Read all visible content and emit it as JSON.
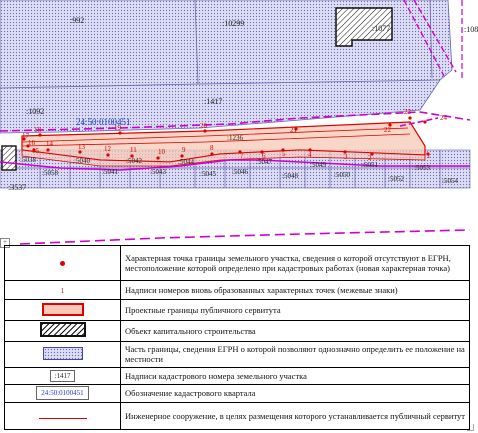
{
  "map": {
    "parcel_labels": [
      ":992",
      ":10299",
      ":1077",
      ":1086",
      ":1092",
      ":1417",
      ":3537",
      ":1236"
    ],
    "quarter_label": "24:50:0100451",
    "lower_labels": [
      ":5038",
      ":5040",
      ":5042",
      ":5044",
      ":5047",
      ":5049",
      ":5051",
      ":5053",
      ":5058",
      ":5041",
      ":5043",
      ":5045",
      ":5046",
      ":5048",
      ":5050",
      ":5052",
      ":5054"
    ],
    "points": [
      "1",
      "2",
      "3",
      "4",
      "5",
      "6",
      "7",
      "8",
      "9",
      "10",
      "11",
      "12",
      "13",
      "14",
      "15",
      "16",
      "17",
      "18",
      "19",
      "20",
      "21",
      "22",
      "23",
      "24"
    ],
    "colors": {
      "servitude": "#e00000",
      "servitude_fill": "#f7c9b6",
      "boundary": "#d000d0",
      "part_fill": "#dcdcf4",
      "quarter": "#1a3ccc"
    }
  },
  "legend": {
    "rows": [
      {
        "symbol": "red-dot",
        "text": "Характерная точка границы земельного участка, сведения о которой отсутствуют в ЕГРН, местоположение которой определено при кадастровых работах (новая характерная точка)"
      },
      {
        "symbol": "point-number",
        "sample": "1",
        "text": "Надписи номеров вновь образованных характерных точек (межевые знаки)"
      },
      {
        "symbol": "servitude-area",
        "text": "Проектные границы публичного сервитута"
      },
      {
        "symbol": "building",
        "text": "Объект капитального строительства"
      },
      {
        "symbol": "parcel-part",
        "text": "Часть границы, сведения ЕГРН о которой позволяют однозначно определить ее положение на местности"
      },
      {
        "symbol": "cadastral-number",
        "sample": ":1417",
        "text": "Надписи кадастрового номера земельного участка"
      },
      {
        "symbol": "quarter-label",
        "sample": "24:50:0100451",
        "text": "Обозначение кадастрового квартала"
      },
      {
        "symbol": "engineering-line",
        "text": "Инженерное сооружение, в целях размещения которого устанавливается публичный сервитут"
      }
    ]
  }
}
